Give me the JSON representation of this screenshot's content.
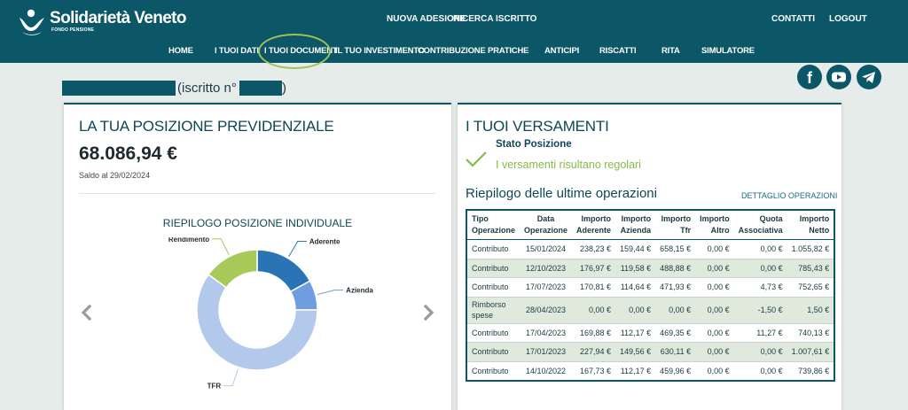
{
  "brand": {
    "name": "Solidarietà Veneto",
    "subtitle": "FONDO PENSIONE"
  },
  "top_links": {
    "nuova_adesione": "NUOVA ADESIONE",
    "ricerca_iscritto": "RICERCA ISCRITTO",
    "contatti": "CONTATTI",
    "logout": "LOGOUT"
  },
  "nav": [
    "HOME",
    "I TUOI DATI",
    "I TUOI DOCUMENTI",
    "IL TUO INVESTIMENTO",
    "CONTRIBUZIONE",
    "PRATICHE",
    "ANTICIPI",
    "RISCATTI",
    "RITA",
    "SIMULATORE"
  ],
  "social": [
    "facebook-icon",
    "youtube-icon",
    "telegram-icon"
  ],
  "user": {
    "iscritto_label": "(iscritto n°",
    "close": ")"
  },
  "posizione": {
    "title": "LA TUA POSIZIONE PREVIDENZIALE",
    "amount": "68.086,94  €",
    "saldo": "Saldo al 29/02/2024",
    "chart_title": "RIEPILOGO POSIZIONE INDIVIDUALE"
  },
  "chart_data": {
    "type": "pie",
    "title": "RIEPILOGO POSIZIONE INDIVIDUALE",
    "categories": [
      "Aderente",
      "Azienda",
      "TFR",
      "Rendimento"
    ],
    "values": [
      17,
      8,
      60,
      15
    ],
    "colors": [
      "#2a74b5",
      "#6f9de0",
      "#b3c9ec",
      "#a9c95a"
    ],
    "donut": true,
    "legend": "labels on slices"
  },
  "versamenti": {
    "title": "I TUOI VERSAMENTI",
    "stato_label": "Stato Posizione",
    "stato_value": "I versamenti risultano regolari",
    "riepilogo": "Riepilogo delle ultime operazioni",
    "dettaglio": "DETTAGLIO OPERAZIONI",
    "columns": [
      [
        "Tipo",
        "Operazione"
      ],
      [
        "Data",
        "Operazione"
      ],
      [
        "Importo",
        "Aderente"
      ],
      [
        "Importo",
        "Azienda"
      ],
      [
        "Importo",
        "Tfr"
      ],
      [
        "Importo",
        "Altro"
      ],
      [
        "Quota",
        "Associativa"
      ],
      [
        "Importo",
        "Netto"
      ]
    ],
    "rows": [
      [
        "Contributo",
        "15/01/2024",
        "238,23 €",
        "159,44 €",
        "658,15 €",
        "0,00 €",
        "0,00 €",
        "1.055,82 €"
      ],
      [
        "Contributo",
        "12/10/2023",
        "176,97 €",
        "119,58 €",
        "488,88 €",
        "0,00 €",
        "0,00 €",
        "785,43 €"
      ],
      [
        "Contributo",
        "17/07/2023",
        "170,81 €",
        "114,64 €",
        "471,93 €",
        "0,00 €",
        "4,73 €",
        "752,65 €"
      ],
      [
        "Rimborso spese",
        "28/04/2023",
        "0,00 €",
        "0,00 €",
        "0,00 €",
        "0,00 €",
        "-1,50 €",
        "1,50 €"
      ],
      [
        "Contributo",
        "17/04/2023",
        "169,88 €",
        "112,17 €",
        "469,35 €",
        "0,00 €",
        "11,27 €",
        "740,13 €"
      ],
      [
        "Contributo",
        "17/01/2023",
        "227,94 €",
        "149,56 €",
        "630,11 €",
        "0,00 €",
        "0,00 €",
        "1.007,61 €"
      ],
      [
        "Contributo",
        "14/10/2022",
        "167,73 €",
        "112,17 €",
        "459,96 €",
        "0,00 €",
        "0,00 €",
        "739,86 €"
      ]
    ]
  }
}
